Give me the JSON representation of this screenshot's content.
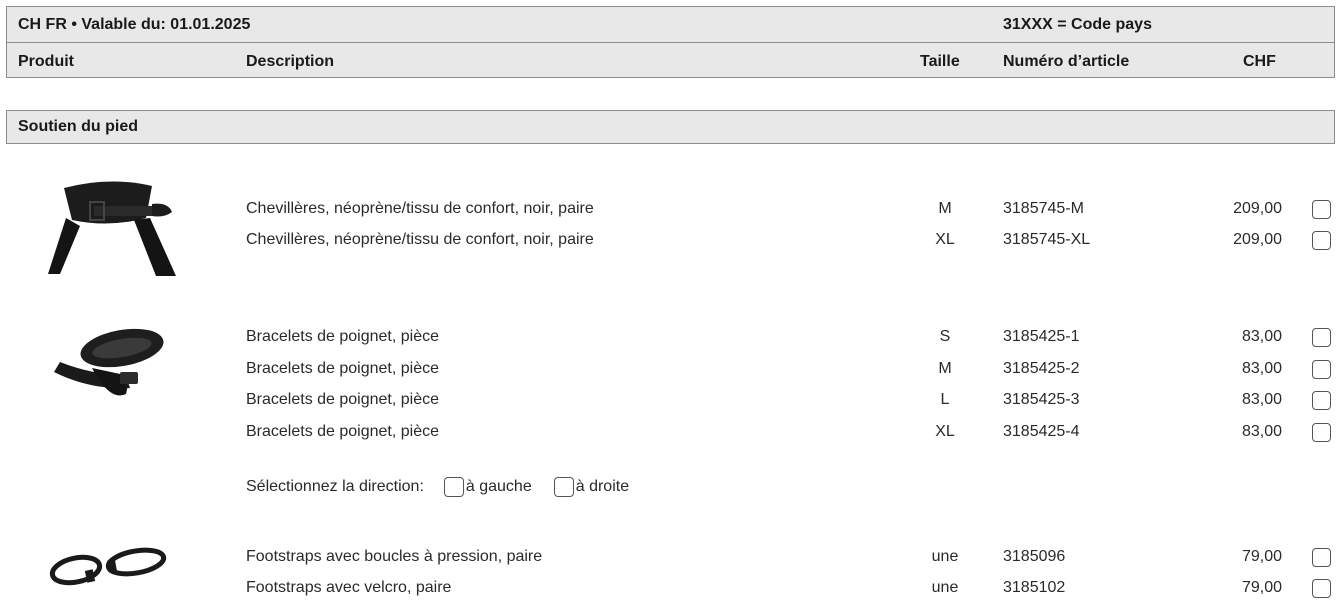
{
  "header": {
    "validity": "CH FR • Valable du: 01.01.2025",
    "country_code_note": "31XXX = Code pays",
    "columns": {
      "product": "Produit",
      "description": "Description",
      "size": "Taille",
      "article_number": "Numéro d’article",
      "currency": "CHF"
    }
  },
  "section": {
    "title": "Soutien du pied"
  },
  "groups": [
    {
      "image_icon": "ankle-brace-icon",
      "rows": [
        {
          "description": "Chevillères, néoprène/tissu de confort, noir, paire",
          "size": "M",
          "article": "3185745-M",
          "price": "209,00"
        },
        {
          "description": "Chevillères, néoprène/tissu de confort, noir, paire",
          "size": "XL",
          "article": "3185745-XL",
          "price": "209,00"
        }
      ]
    },
    {
      "image_icon": "wrist-strap-icon",
      "rows": [
        {
          "description": "Bracelets de poignet, pièce",
          "size": "S",
          "article": "3185425-1",
          "price": "83,00"
        },
        {
          "description": "Bracelets de poignet, pièce",
          "size": "M",
          "article": "3185425-2",
          "price": "83,00"
        },
        {
          "description": "Bracelets de poignet, pièce",
          "size": "L",
          "article": "3185425-3",
          "price": "83,00"
        },
        {
          "description": "Bracelets de poignet, pièce",
          "size": "XL",
          "article": "3185425-4",
          "price": "83,00"
        }
      ],
      "direction": {
        "label": "Sélectionnez la direction:",
        "left": "à gauche",
        "right": "à droite"
      }
    },
    {
      "image_icon": "footstrap-icon",
      "rows": [
        {
          "description": "Footstraps avec boucles à pression, paire",
          "size": "une",
          "article": "3185096",
          "price": "79,00"
        },
        {
          "description": "Footstraps avec velcro, paire",
          "size": "une",
          "article": "3185102",
          "price": "79,00"
        }
      ]
    }
  ]
}
